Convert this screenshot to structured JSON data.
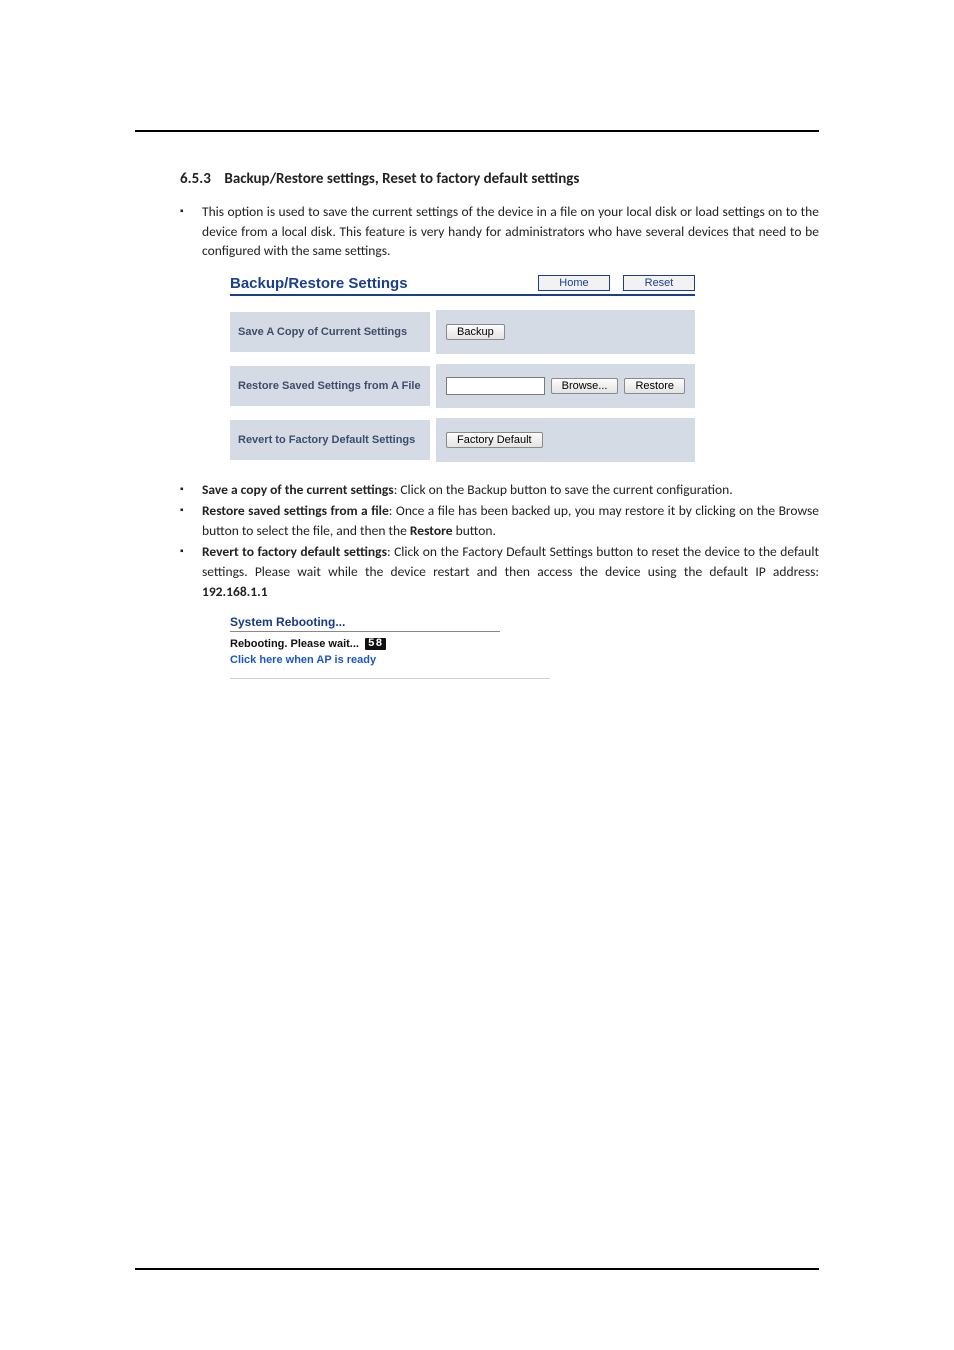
{
  "section": {
    "number": "6.5.3",
    "title": "Backup/Restore settings, Reset to factory default settings"
  },
  "intro_bullet": "This option is used to save the current settings of the device in a file on your local disk or load settings on to the device from a local disk. This feature is very handy for administrators who have several devices that need to be configured with the same settings.",
  "panel": {
    "title": "Backup/Restore Settings",
    "home_btn": "Home",
    "reset_btn": "Reset",
    "rows": {
      "save": {
        "label": "Save A Copy of Current Settings",
        "button": "Backup"
      },
      "restore": {
        "label": "Restore Saved Settings from A File",
        "browse_btn": "Browse...",
        "restore_btn": "Restore"
      },
      "revert": {
        "label": "Revert to Factory Default Settings",
        "button": "Factory Default"
      }
    }
  },
  "bullets": {
    "save_copy_bold": "Save a copy of the current settings",
    "save_copy_rest": ": Click on the Backup button to save the current configuration.",
    "restore_bold": "Restore saved settings from a file",
    "restore_rest_1": ": Once a file has been backed up, you may restore it by clicking on the Browse button to select the file, and then the ",
    "restore_rest_bold2": "Restore",
    "restore_rest_2": " button.",
    "revert_bold": "Revert to factory default settings",
    "revert_rest_1": ": Click on the Factory Default Settings button to reset the device to the default settings. Please wait while the device restart and then access the device using the default IP address: ",
    "revert_ip": "192.168.1.1"
  },
  "reboot": {
    "title": "System Rebooting...",
    "line_prefix": "Rebooting. Please wait...",
    "countdown": "58",
    "link": "Click here when AP is ready"
  }
}
